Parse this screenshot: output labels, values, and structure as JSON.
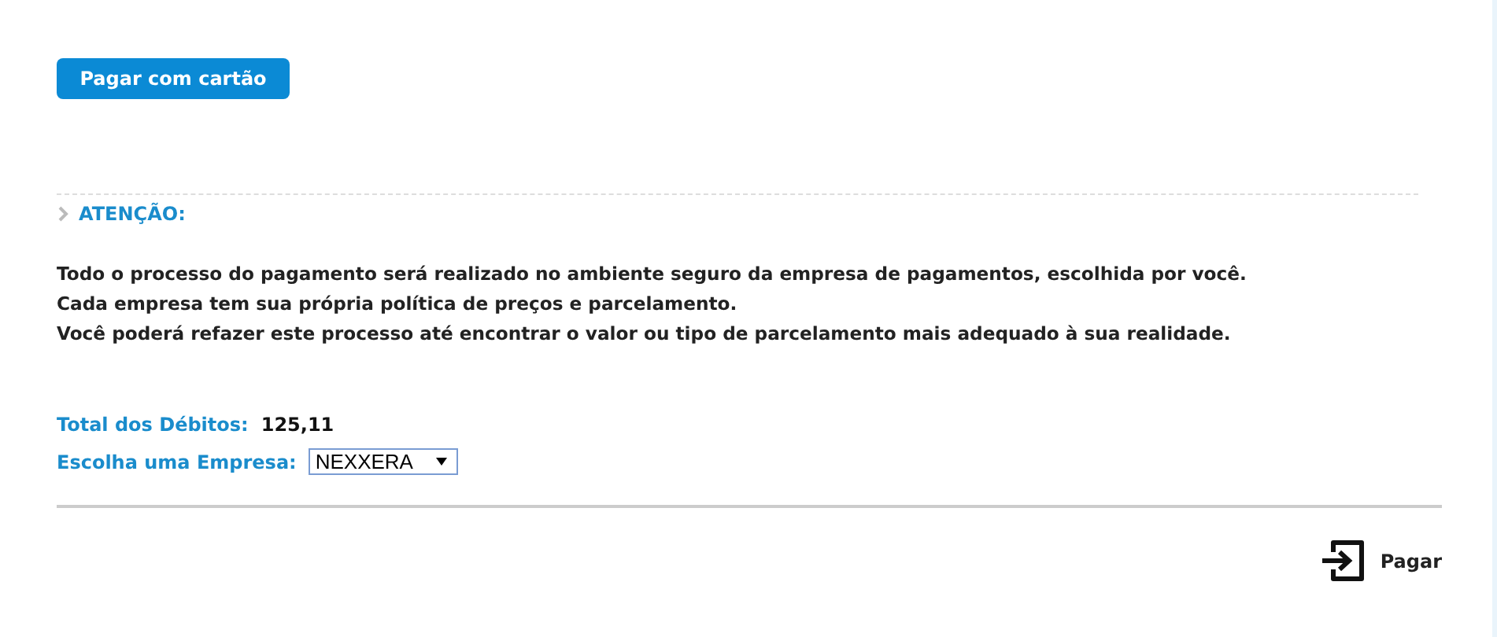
{
  "card_button": {
    "label": "Pagar com cartão"
  },
  "notice": {
    "heading": "ATENÇÃO:",
    "lines": [
      "Todo o processo do pagamento será realizado no ambiente seguro da empresa de pagamentos, escolhida por você.",
      "Cada empresa tem sua própria política de preços e parcelamento.",
      "Você poderá refazer este processo até encontrar o valor ou tipo de parcelamento mais adequado à sua realidade."
    ]
  },
  "total": {
    "label": "Total dos Débitos:",
    "value": "125,11"
  },
  "company": {
    "label": "Escolha uma Empresa:",
    "value": "NEXXERA"
  },
  "pay_button": {
    "label": "Pagar"
  }
}
